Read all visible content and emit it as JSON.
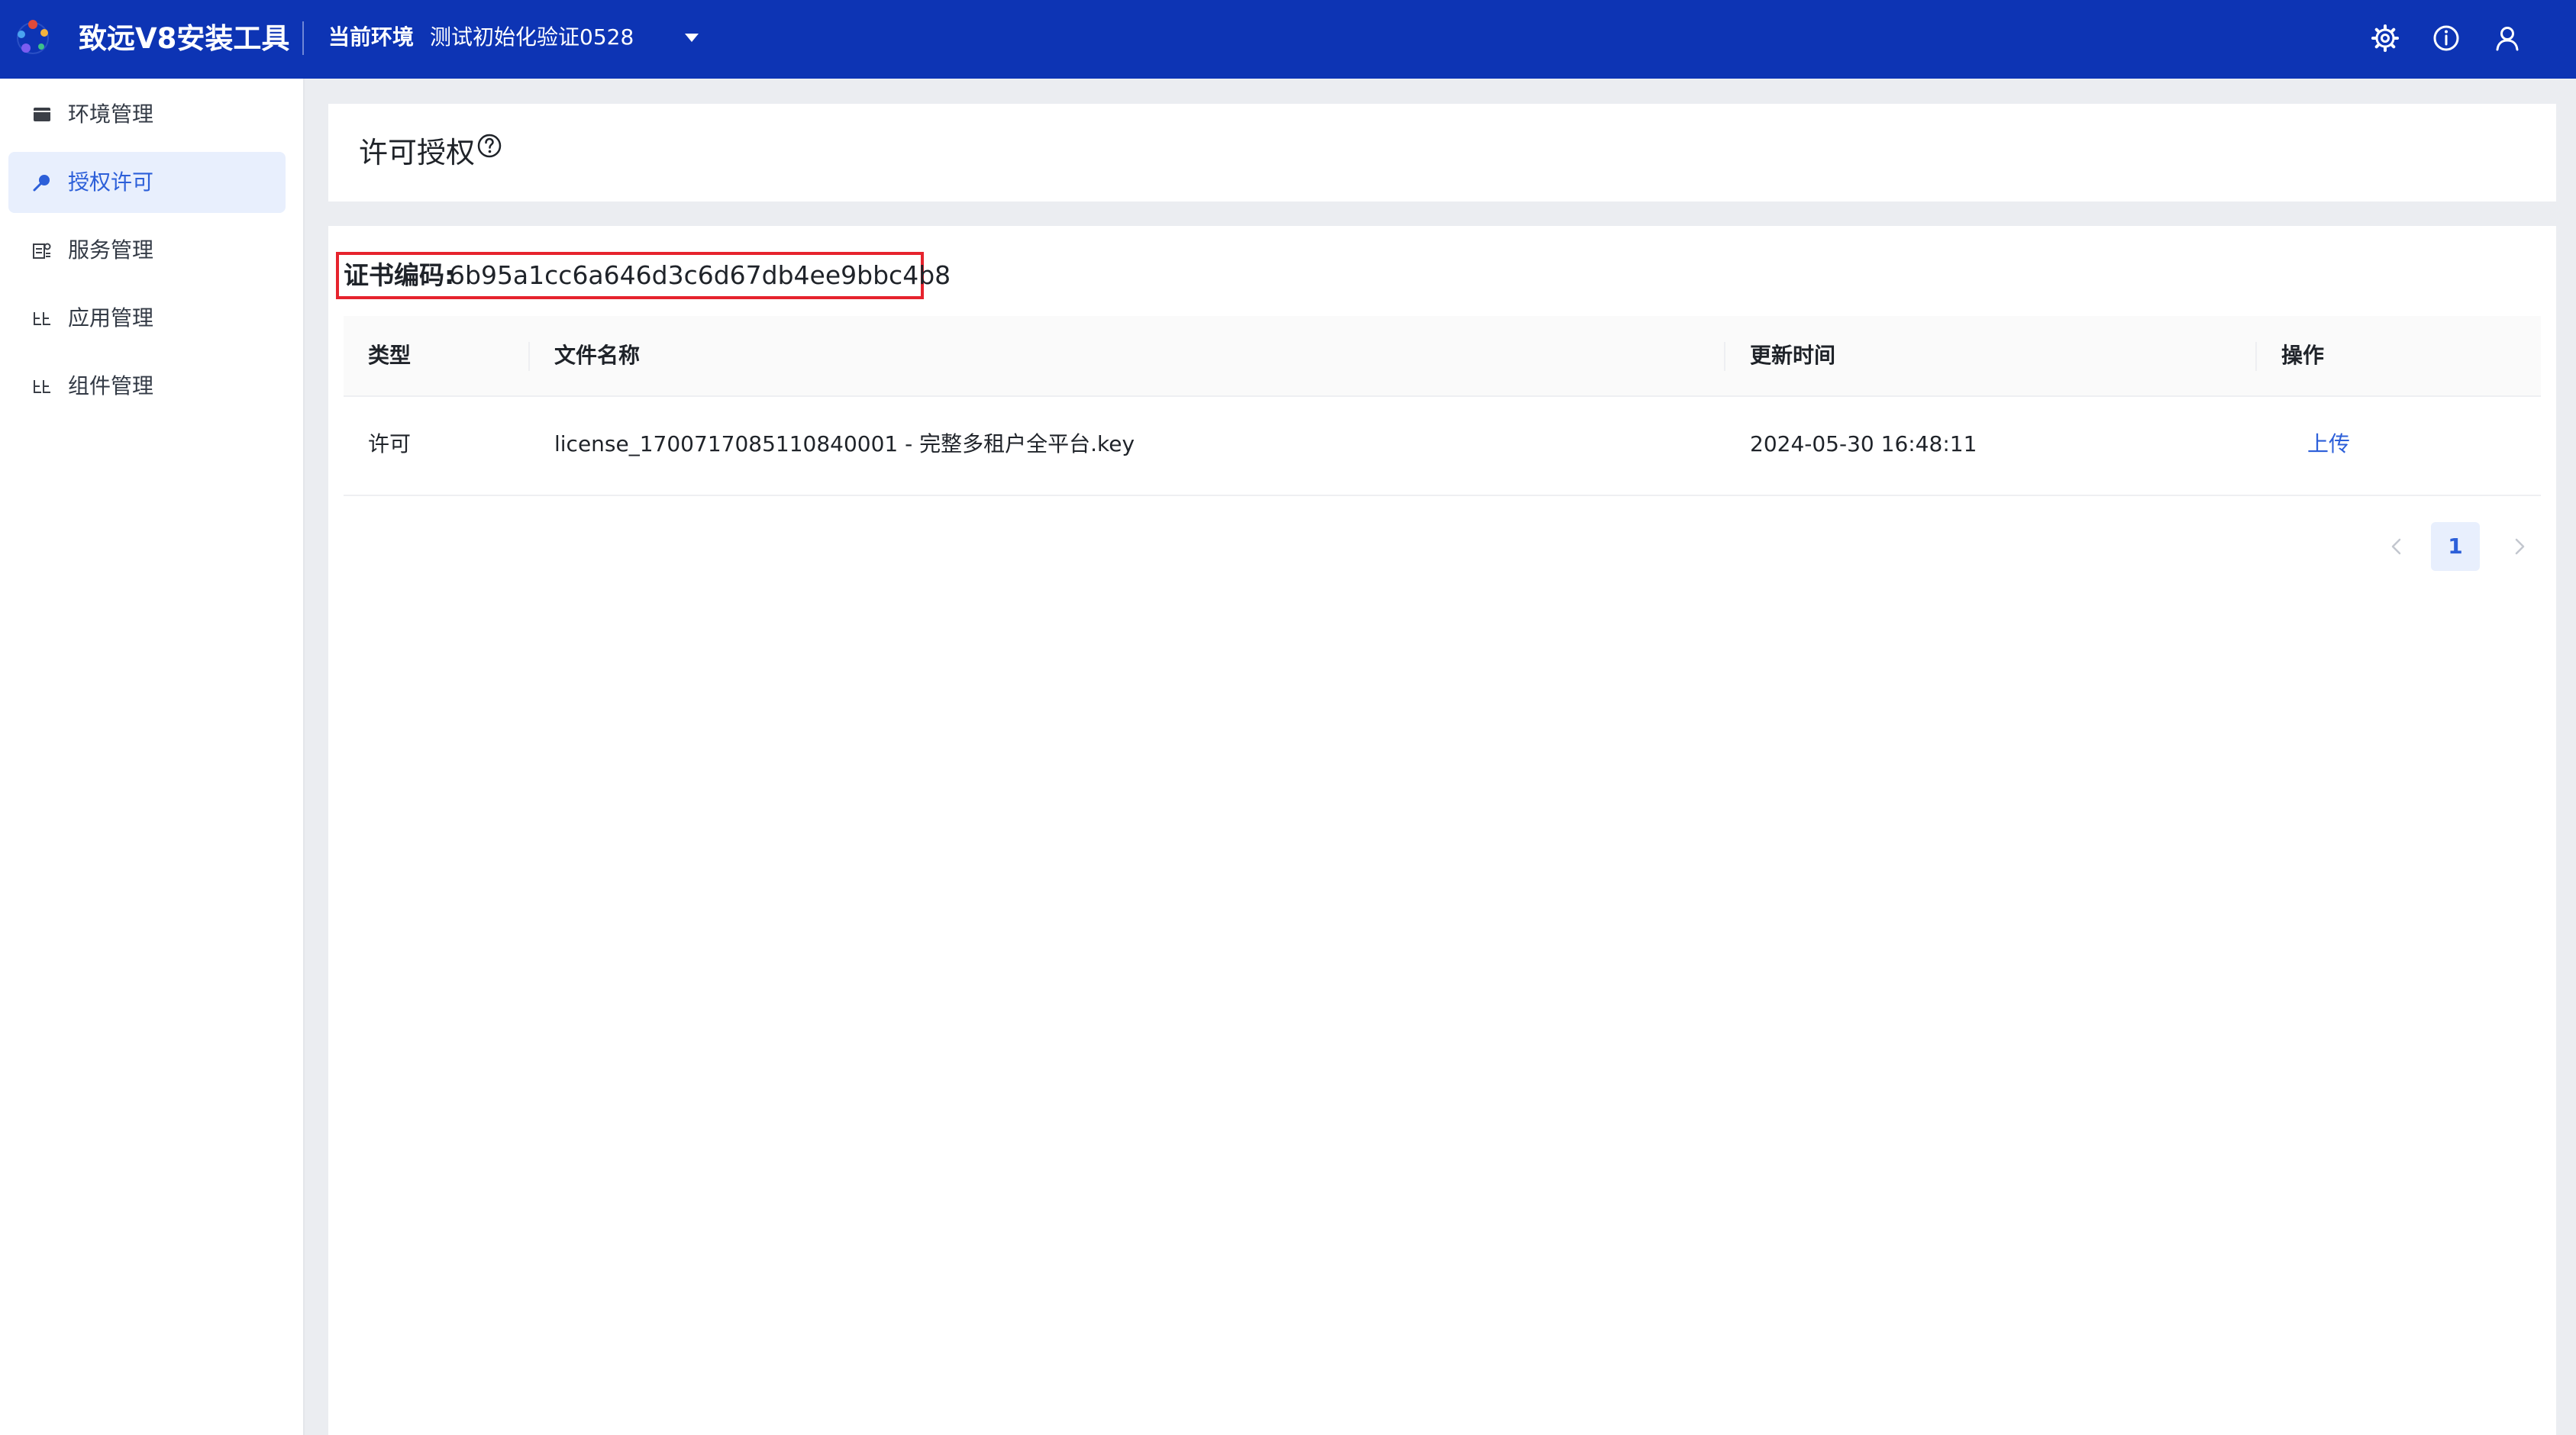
{
  "app": {
    "title": "致远V8安装工具"
  },
  "env": {
    "label": "当前环境",
    "value": "测试初始化验证0528"
  },
  "topbar_icons": [
    "gear-icon",
    "info-icon",
    "user-icon"
  ],
  "sidebar": {
    "items": [
      {
        "label": "环境管理",
        "icon": "folder-icon",
        "active": false
      },
      {
        "label": "授权许可",
        "icon": "key-icon",
        "active": true
      },
      {
        "label": "服务管理",
        "icon": "service-icon",
        "active": false
      },
      {
        "label": "应用管理",
        "icon": "apps-icon",
        "active": false
      },
      {
        "label": "组件管理",
        "icon": "component-icon",
        "active": false
      }
    ]
  },
  "page": {
    "title": "许可授权"
  },
  "certificate": {
    "label": "证书编码:",
    "code": "6b95a1cc6a646d3c6d67db4ee9bbc4b8"
  },
  "table": {
    "columns": [
      "类型",
      "文件名称",
      "更新时间",
      "操作"
    ],
    "rows": [
      {
        "type": "许可",
        "filename": "license_1700717085110840001 - 完整多租户全平台.key",
        "updated": "2024-05-30 16:48:11",
        "action": "上传"
      }
    ]
  },
  "pagination": {
    "current": "1"
  },
  "colors": {
    "topbar": "#0d34b4",
    "accent": "#2c5fd9",
    "active_bg": "#e8effd",
    "highlight_border": "#e6232d"
  }
}
